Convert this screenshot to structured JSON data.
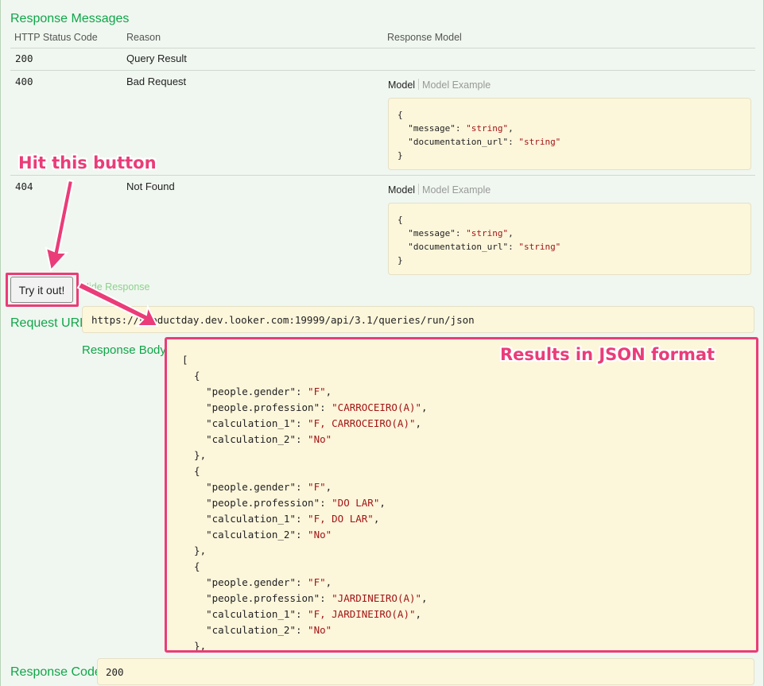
{
  "response_messages": {
    "title": "Response Messages",
    "headers": {
      "status_code": "HTTP Status Code",
      "reason": "Reason",
      "model": "Response Model"
    },
    "rows": [
      {
        "code": "200",
        "reason": "Query Result"
      },
      {
        "code": "400",
        "reason": "Bad Request",
        "model_tab": "Model",
        "example_tab": "Model Example",
        "model_lines": [
          "{",
          "  \"message\": ",
          "\"string\"",
          ",",
          "  \"documentation_url\": ",
          "\"string\"",
          "}"
        ]
      },
      {
        "code": "404",
        "reason": "Not Found",
        "model_tab": "Model",
        "example_tab": "Model Example"
      }
    ]
  },
  "actions": {
    "try_label": "Try it out!",
    "hide_label": "Hide Response"
  },
  "request_url": {
    "label": "Request URL",
    "value": "https://productday.dev.looker.com:19999/api/3.1/queries/run/json"
  },
  "response_body": {
    "label": "Response Body",
    "items": [
      {
        "people.gender": "F",
        "people.profession": "CARROCEIRO(A)",
        "calculation_1": "F, CARROCEIRO(A)",
        "calculation_2": "No"
      },
      {
        "people.gender": "F",
        "people.profession": "DO LAR",
        "calculation_1": "F, DO LAR",
        "calculation_2": "No"
      },
      {
        "people.gender": "F",
        "people.profession": "JARDINEIRO(A)",
        "calculation_1": "F, JARDINEIRO(A)",
        "calculation_2": "No"
      }
    ]
  },
  "response_code": {
    "label": "Response Code",
    "value": "200"
  },
  "annotations": {
    "hit_button": "Hit this button",
    "results": "Results in JSON format"
  },
  "colors": {
    "accent_green": "#10a54a",
    "annotation_pink": "#ea3c78",
    "code_bg": "#fcf6db",
    "string_red": "#a31515"
  }
}
